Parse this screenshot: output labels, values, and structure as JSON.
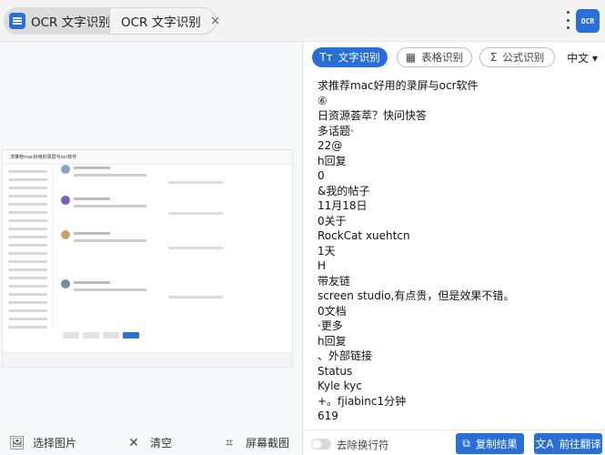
{
  "tabs": [
    {
      "title": "OCR 文字识别",
      "icon": "app-icon"
    },
    {
      "title": "OCR 文字识别",
      "close": "×"
    }
  ],
  "header": {
    "ocr_button": "OCR"
  },
  "preview": {
    "post_title": "求推荐mac好用的录屏与ocr软件"
  },
  "left_toolbar": {
    "select_image": "选择图片",
    "clear": "清空",
    "screenshot": "屏幕截图"
  },
  "modes": {
    "text": "文字识别",
    "table": "表格识别",
    "formula": "公式识别",
    "language": "中文"
  },
  "result_lines": [
    "求推荐mac好用的录屏与ocr软件",
    "⑥",
    "日资源荟萃？快问快答",
    "多话题·",
    "22@",
    "h回复",
    "0",
    "&我的帖子",
    "11月18日",
    "0关于",
    "RockCat xuehtcn",
    "1天",
    "H",
    "带友链",
    "screen studio,有点贵，但是效果不错。",
    "0文档",
    "·更多",
    "h回复",
    "、外部链接",
    "Status",
    "Kyle kyc",
    "+。fjiabinc1分钟",
    "619"
  ],
  "right_toolbar": {
    "nowrap_label": "去除换行符",
    "copy_button": "复制结果",
    "translate_button": "前往翻译"
  },
  "colors": {
    "accent": "#2a6fd8"
  }
}
